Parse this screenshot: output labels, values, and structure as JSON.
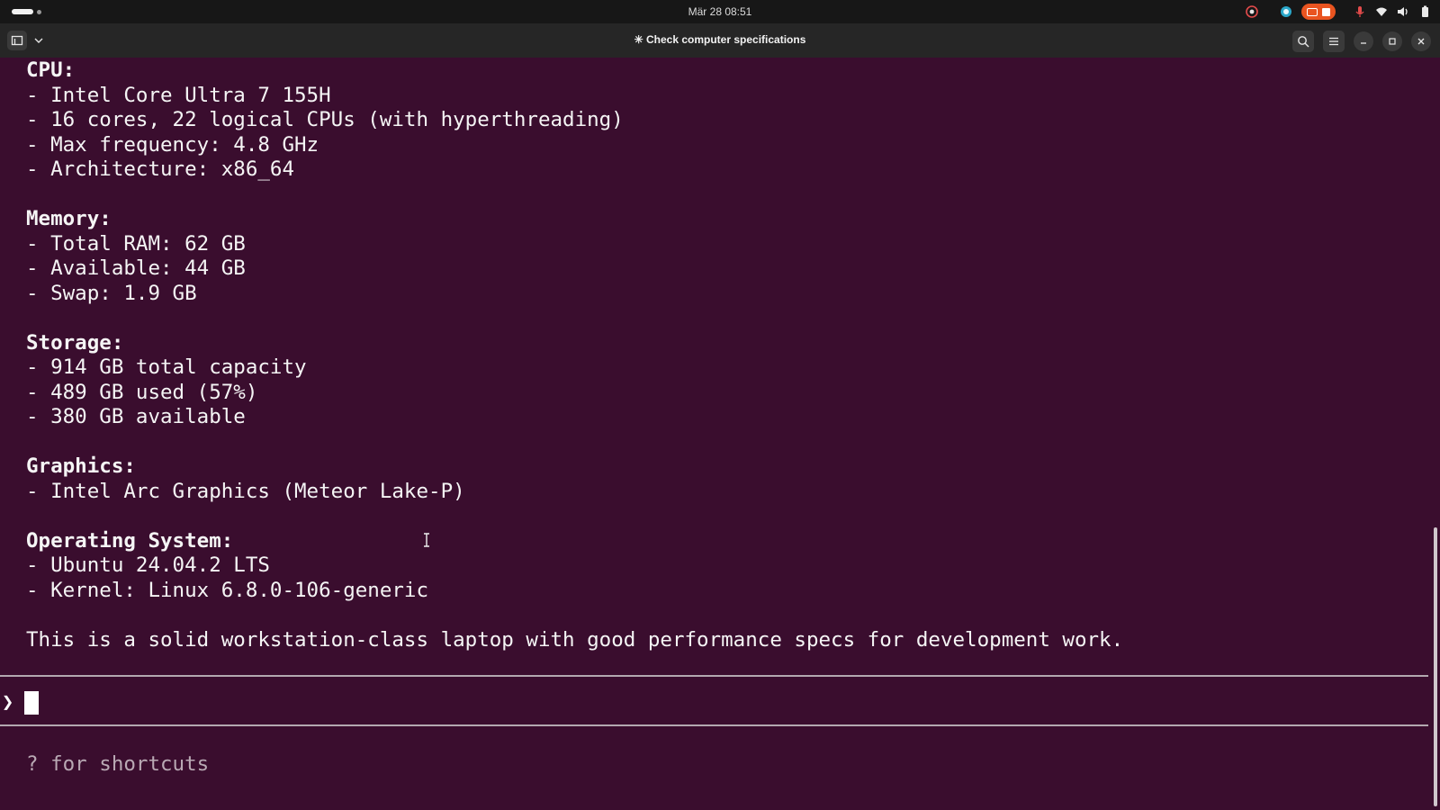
{
  "system_bar": {
    "datetime": "Mär 28  08:51",
    "icons": [
      "chrome-icon",
      "status-dot-icon",
      "screen-record-indicator",
      "microphone-icon",
      "wifi-icon",
      "volume-icon",
      "battery-icon"
    ]
  },
  "window": {
    "title": "✳ Check computer specifications",
    "header_icons": [
      "new-tab-icon",
      "chevron-down-icon",
      "search-icon",
      "menu-icon",
      "minimize-icon",
      "maximize-icon",
      "close-icon"
    ]
  },
  "terminal": {
    "lines": [
      {
        "text": "CPU:",
        "heading": true
      },
      {
        "text": "- Intel Core Ultra 7 155H"
      },
      {
        "text": "- 16 cores, 22 logical CPUs (with hyperthreading)"
      },
      {
        "text": "- Max frequency: 4.8 GHz"
      },
      {
        "text": "- Architecture: x86_64"
      },
      {
        "text": ""
      },
      {
        "text": "Memory:",
        "heading": true
      },
      {
        "text": "- Total RAM: 62 GB"
      },
      {
        "text": "- Available: 44 GB"
      },
      {
        "text": "- Swap: 1.9 GB"
      },
      {
        "text": ""
      },
      {
        "text": "Storage:",
        "heading": true
      },
      {
        "text": "- 914 GB total capacity"
      },
      {
        "text": "- 489 GB used (57%)"
      },
      {
        "text": "- 380 GB available"
      },
      {
        "text": ""
      },
      {
        "text": "Graphics:",
        "heading": true
      },
      {
        "text": "- Intel Arc Graphics (Meteor Lake-P)"
      },
      {
        "text": ""
      },
      {
        "text": "Operating System:",
        "heading": true
      },
      {
        "text": "- Ubuntu 24.04.2 LTS"
      },
      {
        "text": "- Kernel: Linux 6.8.0-106-generic"
      },
      {
        "text": ""
      },
      {
        "text": "This is a solid workstation-class laptop with good performance specs for development work."
      }
    ],
    "prompt_symbol": "❯",
    "input_value": "",
    "hint": "? for shortcuts"
  },
  "colors": {
    "terminal_bg": "#3a0d2e",
    "accent": "#e95420",
    "headerbar_bg": "#262626",
    "topbar_bg": "#171717"
  }
}
